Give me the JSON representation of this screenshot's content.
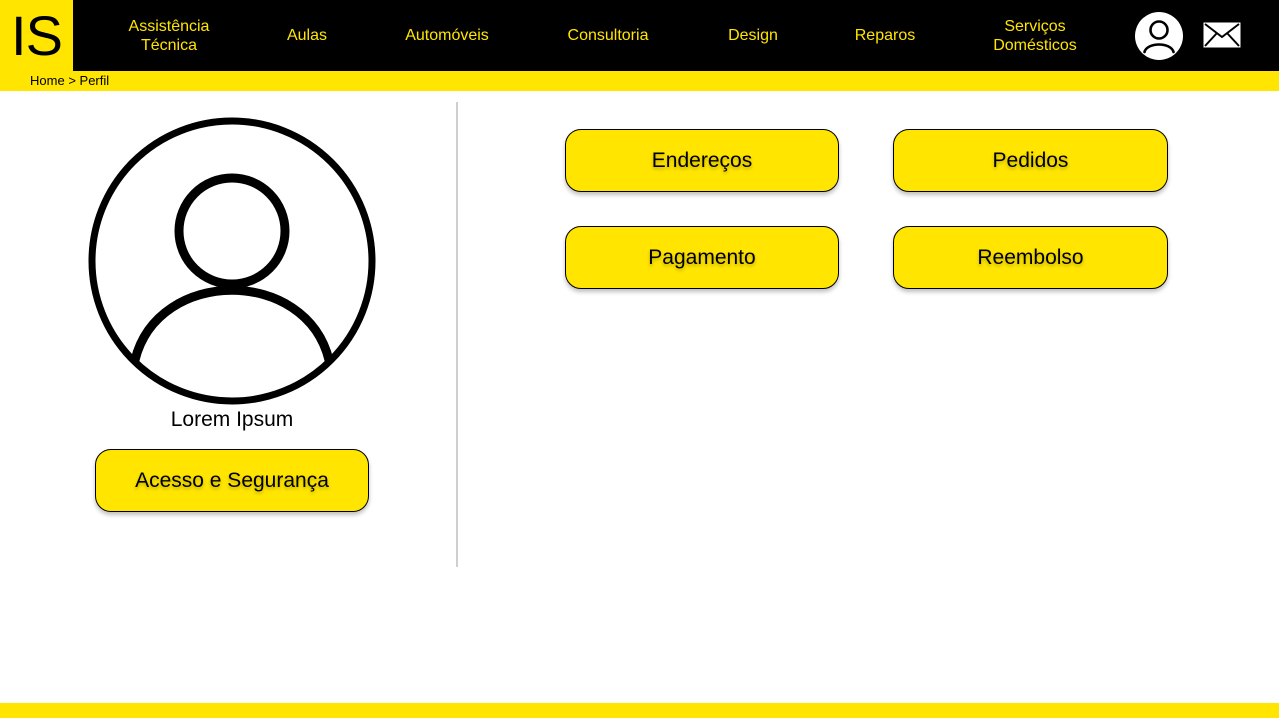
{
  "brand": {
    "logo_text": "IS"
  },
  "nav": {
    "items": [
      {
        "line1": "Assistência",
        "line2": "Técnica"
      },
      {
        "line1": "Aulas",
        "line2": ""
      },
      {
        "line1": "Automóveis",
        "line2": ""
      },
      {
        "line1": "Consultoria",
        "line2": ""
      },
      {
        "line1": "Design",
        "line2": ""
      },
      {
        "line1": "Reparos",
        "line2": ""
      },
      {
        "line1": "Serviços",
        "line2": "Domésticos"
      }
    ],
    "profile_icon": "user-circle-icon",
    "mail_icon": "envelope-icon"
  },
  "breadcrumb": {
    "home": "Home",
    "separator": ">",
    "current": "Perfil"
  },
  "profile": {
    "avatar_icon": "user-avatar-icon",
    "name": "Lorem Ipsum",
    "security_button": "Acesso e Segurança"
  },
  "actions": {
    "addresses": "Endereços",
    "orders": "Pedidos",
    "payment": "Pagamento",
    "refund": "Reembolso"
  },
  "colors": {
    "accent": "#ffe500",
    "header_bg": "#000000",
    "background": "#ffffff",
    "divider": "#cfcfcf"
  }
}
